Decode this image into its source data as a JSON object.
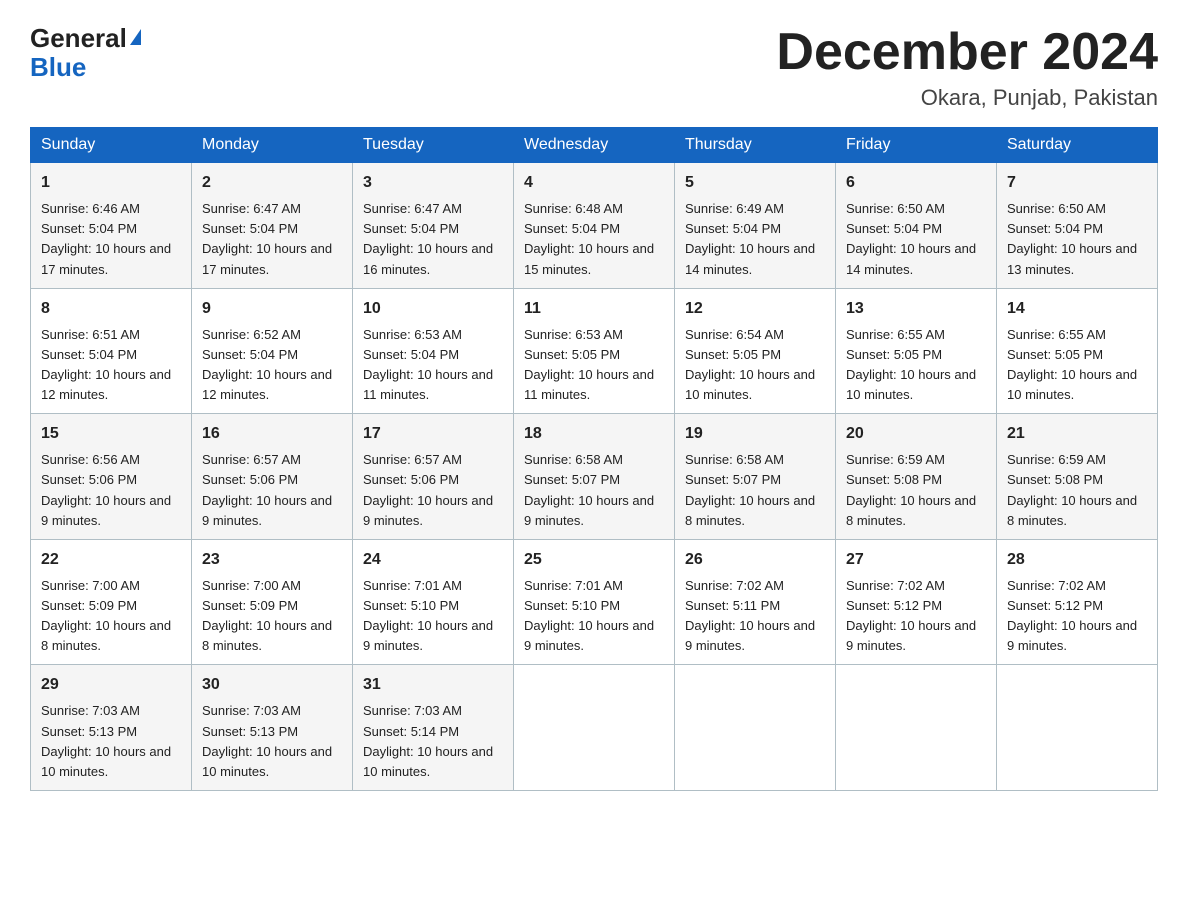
{
  "header": {
    "logo_line1": "General",
    "logo_line2": "Blue",
    "month_title": "December 2024",
    "location": "Okara, Punjab, Pakistan"
  },
  "days_of_week": [
    "Sunday",
    "Monday",
    "Tuesday",
    "Wednesday",
    "Thursday",
    "Friday",
    "Saturday"
  ],
  "weeks": [
    [
      {
        "day": "1",
        "sunrise": "6:46 AM",
        "sunset": "5:04 PM",
        "daylight": "10 hours and 17 minutes."
      },
      {
        "day": "2",
        "sunrise": "6:47 AM",
        "sunset": "5:04 PM",
        "daylight": "10 hours and 17 minutes."
      },
      {
        "day": "3",
        "sunrise": "6:47 AM",
        "sunset": "5:04 PM",
        "daylight": "10 hours and 16 minutes."
      },
      {
        "day": "4",
        "sunrise": "6:48 AM",
        "sunset": "5:04 PM",
        "daylight": "10 hours and 15 minutes."
      },
      {
        "day": "5",
        "sunrise": "6:49 AM",
        "sunset": "5:04 PM",
        "daylight": "10 hours and 14 minutes."
      },
      {
        "day": "6",
        "sunrise": "6:50 AM",
        "sunset": "5:04 PM",
        "daylight": "10 hours and 14 minutes."
      },
      {
        "day": "7",
        "sunrise": "6:50 AM",
        "sunset": "5:04 PM",
        "daylight": "10 hours and 13 minutes."
      }
    ],
    [
      {
        "day": "8",
        "sunrise": "6:51 AM",
        "sunset": "5:04 PM",
        "daylight": "10 hours and 12 minutes."
      },
      {
        "day": "9",
        "sunrise": "6:52 AM",
        "sunset": "5:04 PM",
        "daylight": "10 hours and 12 minutes."
      },
      {
        "day": "10",
        "sunrise": "6:53 AM",
        "sunset": "5:04 PM",
        "daylight": "10 hours and 11 minutes."
      },
      {
        "day": "11",
        "sunrise": "6:53 AM",
        "sunset": "5:05 PM",
        "daylight": "10 hours and 11 minutes."
      },
      {
        "day": "12",
        "sunrise": "6:54 AM",
        "sunset": "5:05 PM",
        "daylight": "10 hours and 10 minutes."
      },
      {
        "day": "13",
        "sunrise": "6:55 AM",
        "sunset": "5:05 PM",
        "daylight": "10 hours and 10 minutes."
      },
      {
        "day": "14",
        "sunrise": "6:55 AM",
        "sunset": "5:05 PM",
        "daylight": "10 hours and 10 minutes."
      }
    ],
    [
      {
        "day": "15",
        "sunrise": "6:56 AM",
        "sunset": "5:06 PM",
        "daylight": "10 hours and 9 minutes."
      },
      {
        "day": "16",
        "sunrise": "6:57 AM",
        "sunset": "5:06 PM",
        "daylight": "10 hours and 9 minutes."
      },
      {
        "day": "17",
        "sunrise": "6:57 AM",
        "sunset": "5:06 PM",
        "daylight": "10 hours and 9 minutes."
      },
      {
        "day": "18",
        "sunrise": "6:58 AM",
        "sunset": "5:07 PM",
        "daylight": "10 hours and 9 minutes."
      },
      {
        "day": "19",
        "sunrise": "6:58 AM",
        "sunset": "5:07 PM",
        "daylight": "10 hours and 8 minutes."
      },
      {
        "day": "20",
        "sunrise": "6:59 AM",
        "sunset": "5:08 PM",
        "daylight": "10 hours and 8 minutes."
      },
      {
        "day": "21",
        "sunrise": "6:59 AM",
        "sunset": "5:08 PM",
        "daylight": "10 hours and 8 minutes."
      }
    ],
    [
      {
        "day": "22",
        "sunrise": "7:00 AM",
        "sunset": "5:09 PM",
        "daylight": "10 hours and 8 minutes."
      },
      {
        "day": "23",
        "sunrise": "7:00 AM",
        "sunset": "5:09 PM",
        "daylight": "10 hours and 8 minutes."
      },
      {
        "day": "24",
        "sunrise": "7:01 AM",
        "sunset": "5:10 PM",
        "daylight": "10 hours and 9 minutes."
      },
      {
        "day": "25",
        "sunrise": "7:01 AM",
        "sunset": "5:10 PM",
        "daylight": "10 hours and 9 minutes."
      },
      {
        "day": "26",
        "sunrise": "7:02 AM",
        "sunset": "5:11 PM",
        "daylight": "10 hours and 9 minutes."
      },
      {
        "day": "27",
        "sunrise": "7:02 AM",
        "sunset": "5:12 PM",
        "daylight": "10 hours and 9 minutes."
      },
      {
        "day": "28",
        "sunrise": "7:02 AM",
        "sunset": "5:12 PM",
        "daylight": "10 hours and 9 minutes."
      }
    ],
    [
      {
        "day": "29",
        "sunrise": "7:03 AM",
        "sunset": "5:13 PM",
        "daylight": "10 hours and 10 minutes."
      },
      {
        "day": "30",
        "sunrise": "7:03 AM",
        "sunset": "5:13 PM",
        "daylight": "10 hours and 10 minutes."
      },
      {
        "day": "31",
        "sunrise": "7:03 AM",
        "sunset": "5:14 PM",
        "daylight": "10 hours and 10 minutes."
      },
      null,
      null,
      null,
      null
    ]
  ]
}
